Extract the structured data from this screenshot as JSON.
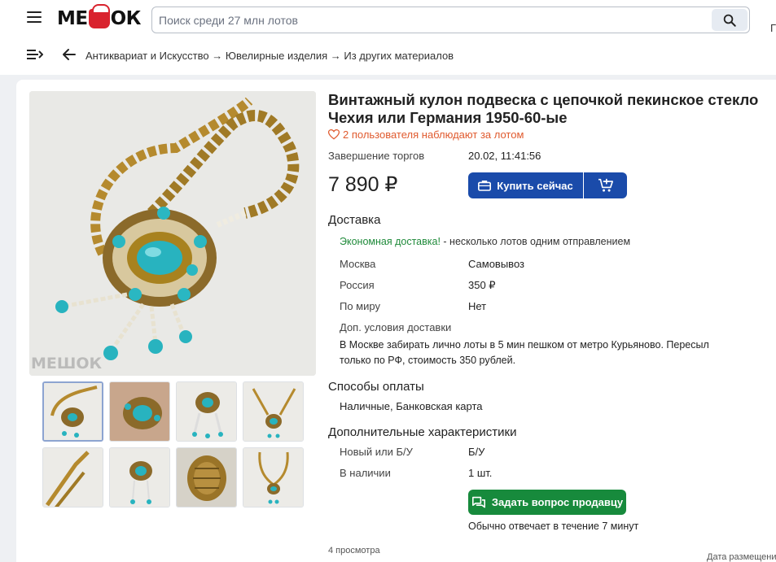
{
  "header": {
    "logo_text": [
      "МЕ",
      "ОК"
    ],
    "search_placeholder": "Поиск среди 27 млн лотов",
    "edge_text": "Г"
  },
  "breadcrumb": "Антиквариат и Искусство → Ювелирные изделия → Из других материалов",
  "lot": {
    "title": "Винтажный кулон подвеска с цепочкой пекинское стекло Чехия или Германия 1950-60-ые",
    "watchers": "2 пользователя наблюдают за лотом",
    "end_label": "Завершение торгов",
    "end_value": "20.02, 11:41:56",
    "price": "7 890 ₽",
    "buy_label": "Купить сейчас",
    "watermark": "МЕШОК"
  },
  "delivery": {
    "heading": "Доставка",
    "eco_highlight": "Экономная доставка!",
    "eco_rest": " - несколько лотов одним отправлением",
    "rows": [
      {
        "label": "Москва",
        "value": "Самовывоз"
      },
      {
        "label": "Россия",
        "value": "350 ₽"
      },
      {
        "label": "По миру",
        "value": "Нет"
      }
    ],
    "extra_label": "Доп. условия доставки",
    "extra_text": "В Москве забирать лично лоты в 5 мин пешком от метро Курьяново. Пересыл только по РФ, стоимость 350 рублей."
  },
  "payment": {
    "heading": "Способы оплаты",
    "methods": "Наличные, Банковская карта"
  },
  "characteristics": {
    "heading": "Дополнительные характеристики",
    "rows": [
      {
        "label": "Новый или Б/У",
        "value": "Б/У"
      },
      {
        "label": "В наличии",
        "value": "1 шт."
      }
    ]
  },
  "seller": {
    "ask_label": "Задать вопрос продавцу",
    "reply_text": "Обычно отвечает в течение 7 минут"
  },
  "footer": {
    "views": "4 просмотра",
    "date_added": "Дата размещени"
  },
  "colors": {
    "primary": "#1a4baa",
    "green": "#178a3c",
    "watchers": "#e05a2e",
    "eco": "#1f8a3a"
  }
}
